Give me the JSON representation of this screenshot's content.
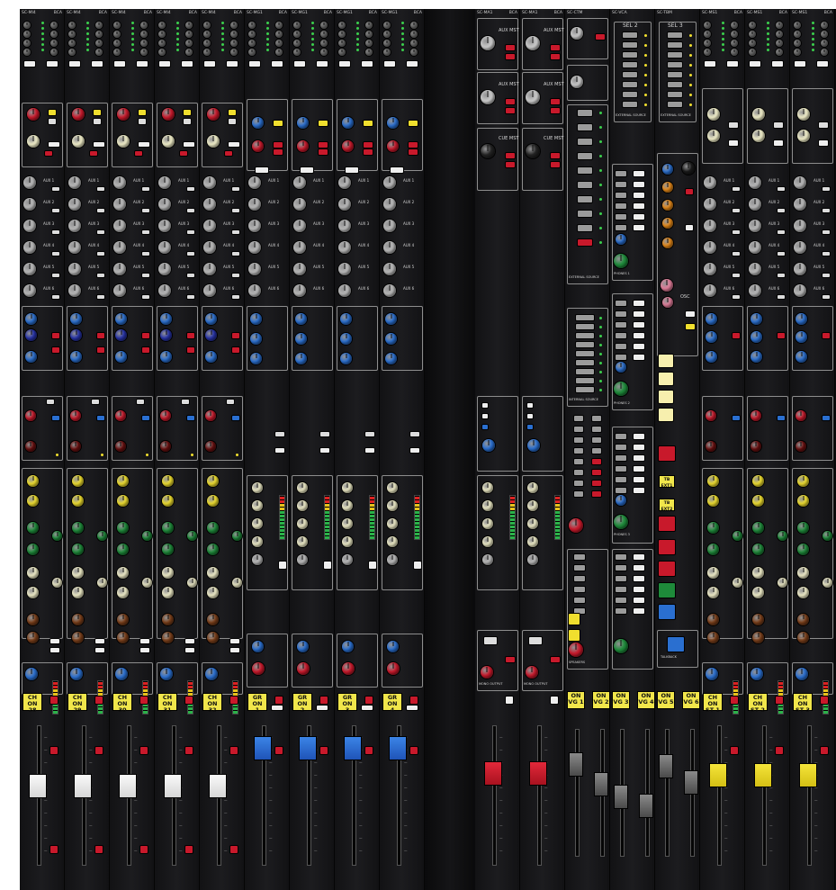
{
  "colors": {
    "ch_on": "#f1e64b",
    "red": "#c8192b",
    "blue": "#2a6fd0",
    "grey": "#9b9b9b",
    "cream": "#f2efc9",
    "yellow": "#f0df2e",
    "green": "#1e8a3a",
    "brown": "#7a3f1a",
    "navy": "#2733a8",
    "dark_red": "#6b1010",
    "orange": "#e88a18",
    "pink": "#e27d9a",
    "ch_on_yellow": "#f1e64b"
  },
  "input_strips": [
    {
      "module": "SC-MI4",
      "sub": "BCA",
      "on": "CH ON",
      "num": "28"
    },
    {
      "module": "SC-MI4",
      "sub": "BCA",
      "on": "CH ON",
      "num": "29"
    },
    {
      "module": "SC-MI4",
      "sub": "BCA",
      "on": "CH ON",
      "num": "30"
    },
    {
      "module": "SC-MI4",
      "sub": "BCA",
      "on": "CH ON",
      "num": "31"
    },
    {
      "module": "SC-MI4",
      "sub": "BCA",
      "on": "CH ON",
      "num": "32"
    }
  ],
  "group_strips": [
    {
      "module": "SC-MG1",
      "sub": "BCA",
      "on": "GR ON",
      "num": "1"
    },
    {
      "module": "SC-MG1",
      "sub": "BCA",
      "on": "GR ON",
      "num": "2"
    },
    {
      "module": "SC-MG1",
      "sub": "BCA",
      "on": "GR ON",
      "num": "3"
    },
    {
      "module": "SC-MG1",
      "sub": "BCA",
      "on": "GR ON",
      "num": "4"
    }
  ],
  "aux_strips": [
    {
      "module": "SC-MA1",
      "sub": "BCA",
      "labels": [
        "AUX MST",
        "AUX MST",
        "CUE MST"
      ],
      "out": "MONO OUTPUT"
    },
    {
      "module": "SC-MA1",
      "sub": "BCA",
      "labels": [
        "AUX MST",
        "AUX MST",
        "CUE MST"
      ],
      "out": "MONO OUTPUT"
    }
  ],
  "vg_strips": [
    {
      "on": "ON",
      "num": "VG 1"
    },
    {
      "on": "ON",
      "num": "VG 2"
    },
    {
      "on": "ON",
      "num": "VG 3"
    },
    {
      "on": "ON",
      "num": "VG 4"
    },
    {
      "on": "ON",
      "num": "VG 5"
    },
    {
      "on": "ON",
      "num": "VG 6"
    }
  ],
  "stereo_strips": [
    {
      "module": "SC-MS1",
      "sub": "BCA",
      "on": "CH ON",
      "num": "ST 1"
    },
    {
      "module": "SC-MS1",
      "sub": "BCA",
      "on": "CH ON",
      "num": "ST 2"
    },
    {
      "module": "SC-MS1",
      "sub": "BCA",
      "on": "CH ON",
      "num": "ST 3"
    }
  ],
  "master": {
    "module_a": "SC-CTM",
    "module_b": "SC-VCA",
    "module_c": "SC-TBM",
    "sel_a": "SEL 2",
    "sel_b": "SEL 3",
    "ext_source": "EXTERNAL SOURCE",
    "int_source": "INTERNAL SOURCE",
    "phones_1": "PHONES 1",
    "phones_2": "PHONES 2",
    "phones_3": "PHONES 3",
    "speakers": "SPEAKERS",
    "osc": "OSC",
    "tb_ext1": "TB EXT1",
    "tb_ext2": "TB EXT2",
    "talkback": "TALKBACK"
  },
  "aux_labels": [
    "AUX 1",
    "AUX 2",
    "AUX 3",
    "AUX 4",
    "AUX 5",
    "AUX 6"
  ]
}
